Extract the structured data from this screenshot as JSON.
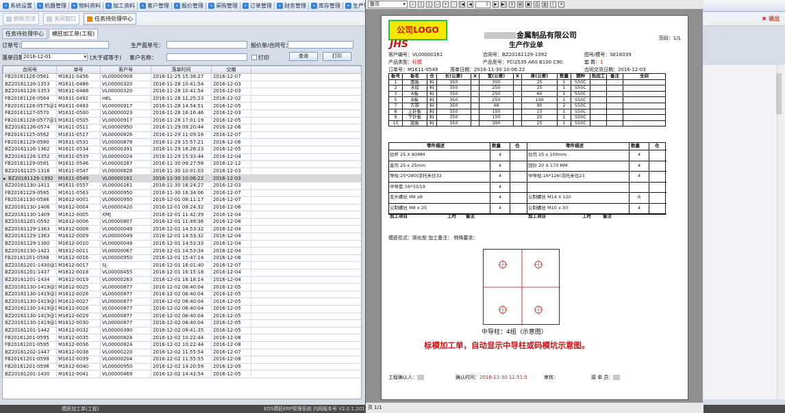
{
  "toolbar": {
    "items": [
      "系统设置",
      "机器管理",
      "物料资料",
      "加工资料",
      "客户管理",
      "报价管理",
      "采购管理",
      "订单管理",
      "财务管理",
      "库存管理",
      "生产管"
    ]
  },
  "row2": {
    "btn1": "刷新方法",
    "btn2": "关闭窗口",
    "btn3": "任务待处理中心",
    "exit": "退出"
  },
  "tabs": [
    "任务待处理中心",
    "模胚加工单(工程)"
  ],
  "filters": {
    "order_no_label": "订单号：",
    "production_no_label": "生产面单号：",
    "quote_label": "报价单/合同号：",
    "date_label": "落单日期：",
    "date_value": "2016-12-01",
    "date_hint": "(大于或等于)",
    "customer_label": "客户名称：",
    "print_label": "打印",
    "query_btn": "查询",
    "print_btn": "打印"
  },
  "grid": {
    "headers": [
      "合同号",
      "单号",
      "客户号",
      "落单时间",
      "交期"
    ],
    "rows": [
      [
        "FB20161126-0561",
        "M1611-0456",
        "VL00000908",
        "2016-11-25 15:38:27",
        "2016-12-07"
      ],
      [
        "BZ20161126-1353",
        "M1611-0486",
        "VL00000320",
        "2016-11-28 10:41:54",
        "2016-12-03"
      ],
      [
        "BZ20161126-1353",
        "M1611-0488",
        "VL00000320",
        "2016-11-28 10:41:54",
        "2016-12-03"
      ],
      [
        "FB20161126-0564",
        "M1611-0492",
        "HKL",
        "2016-11-28 11:25:23",
        "2016-12-02"
      ],
      [
        "FB20161128-0575@1",
        "M1611-0493",
        "VL00000917",
        "2016-11-28 14:54:51",
        "2016-12-05"
      ],
      [
        "FB20161127-0570",
        "M1611-0500",
        "VL00000023",
        "2016-11-28 16:16:46",
        "2016-12-03"
      ],
      [
        "FB20161128-0577@1",
        "M1611-0505",
        "VL00000917",
        "2016-11-28 17:01:19",
        "2016-12-05"
      ],
      [
        "BZ20161126-0574",
        "M1611-0511",
        "VL00000950",
        "2016-11-29 09:20:44",
        "2016-12-06"
      ],
      [
        "FB20161125-0562",
        "M1611-0517",
        "VL00000826",
        "2016-11-29 11:09:16",
        "2016-12-07"
      ],
      [
        "FB20161129-0580",
        "M1611-0531",
        "VL00000878",
        "2016-11-29 15:57:21",
        "2016-12-06"
      ],
      [
        "BZ20161126-1362",
        "M1611-0534",
        "VL00000391",
        "2016-11-29 16:26:23",
        "2016-12-05"
      ],
      [
        "BZ20161126-1352",
        "M1611-0539",
        "VL00000024",
        "2016-11-29 15:33:44",
        "2016-12-04"
      ],
      [
        "FB20161129-0581",
        "M1611-0546",
        "VL00000287",
        "2016-11-30 09:27:58",
        "2016-12-12"
      ],
      [
        "BZ20161125-1316",
        "M1611-0547",
        "VL00000828",
        "2016-11-30 10:01:03",
        "2016-12-03"
      ],
      [
        "BZ20161129-1392",
        "M1611-0549",
        "VL00000161",
        "2016-11-30 10:06:22",
        "2016-12-03"
      ],
      [
        "BZ20161130-1411",
        "M1611-0557",
        "VL00000161",
        "2016-11-30 16:24:27",
        "2016-12-03"
      ],
      [
        "FB20161129-0585",
        "M1611-0563",
        "VL00000950",
        "2016-11-30 16:34:06",
        "2016-12-07"
      ],
      [
        "FB20161130-0586",
        "M1612-0001",
        "VL00000950",
        "2016-12-01 08:11:17",
        "2016-12-07"
      ],
      [
        "BZ20161130-1406",
        "M1612-0004",
        "VL00000420",
        "2016-12-01 09:24:32",
        "2016-12-06"
      ],
      [
        "BZ20161130-1409",
        "M1612-0005",
        "XMJ",
        "2016-12-01 11:42:39",
        "2016-12-04"
      ],
      [
        "BZ20161201-0592",
        "M1612-0006",
        "VL00000807",
        "2016-12-01 11:49:36",
        "2016-12-08"
      ],
      [
        "BZ20161129-1363",
        "M1612-0008",
        "VL00000049",
        "2016-12-01 14:53:32",
        "2016-12-04"
      ],
      [
        "BZ20161129-1363",
        "M1612-0009",
        "VL00000049",
        "2016-12-01 14:53:32",
        "2016-12-04"
      ],
      [
        "BZ20161129-1380",
        "M1612-0010",
        "VL00000049",
        "2016-12-01 14:53:33",
        "2016-12-04"
      ],
      [
        "BZ20161130-1421",
        "M1612-0011",
        "VL00000067",
        "2016-12-01 14:53:34",
        "2016-12-04"
      ],
      [
        "FB20161201-0588",
        "M1612-0016",
        "VL00000950",
        "2016-12-01 15:47:14",
        "2016-12-08"
      ],
      [
        "BZ20161201-1430@1",
        "M1612-0017",
        "SJ",
        "2016-12-01 16:01:40",
        "2016-12-07"
      ],
      [
        "BZ20161201-1437",
        "M1612-0018",
        "VL00000455",
        "2016-12-01 16:15:18",
        "2016-12-04"
      ],
      [
        "BZ20161201-1434",
        "M1612-0019",
        "VL00000263",
        "2016-12-01 16:18:14",
        "2016-12-04"
      ],
      [
        "BZ20161130-1419@1",
        "M1612-0025",
        "VL00000877",
        "2016-12-02 08:40:04",
        "2016-12-05"
      ],
      [
        "BZ20161130-1419@1",
        "M1612-0026",
        "VL00000877",
        "2016-12-02 08:40:04",
        "2016-12-05"
      ],
      [
        "BZ20161130-1419@1",
        "M1612-0027",
        "VL00000877",
        "2016-12-02 08:40:04",
        "2016-12-05"
      ],
      [
        "BZ20161130-1419@1",
        "M1612-0028",
        "VL00000877",
        "2016-12-02 08:40:04",
        "2016-12-05"
      ],
      [
        "BZ20161130-1419@1",
        "M1612-0029",
        "VL00000877",
        "2016-12-02 08:40:04",
        "2016-12-05"
      ],
      [
        "BZ20161130-1419@1",
        "M1612-0030",
        "VL00000877",
        "2016-12-02 08:40:04",
        "2016-12-05"
      ],
      [
        "BZ20161201-1442",
        "M1612-0032",
        "VL00000390",
        "2016-12-02 09:41:35",
        "2016-12-05"
      ],
      [
        "FB20161201-0595",
        "M1612-0035",
        "VL00000824",
        "2016-12-02 10:22:44",
        "2016-12-08"
      ],
      [
        "FB20161201-0595",
        "M1612-0036",
        "VL00000824",
        "2016-12-02 10:22:44",
        "2016-12-08"
      ],
      [
        "BZ20161202-1447",
        "M1612-0038",
        "VL00000220",
        "2016-12-02 11:55:54",
        "2016-12-07"
      ],
      [
        "FB20161201-0599",
        "M1612-0039",
        "VL00000204",
        "2016-12-02 11:55:55",
        "2016-12-08"
      ],
      [
        "FB20161201-0598",
        "M1612-0040",
        "VL00000950",
        "2016-12-02 14:20:59",
        "2016-12-09"
      ],
      [
        "BZ20161201-1430",
        "M1612-0041",
        "VL00000469",
        "2016-12-02 14:43:54",
        "2016-12-05"
      ]
    ],
    "selected_index": 14
  },
  "statusbar": {
    "left": "模胚加工单(工程)",
    "mid": "EOS模胚ERP管理系统 内网版本号 V2.0.1.2016"
  },
  "viewer": {
    "zoom": "整页",
    "page_input": "1",
    "page_status": "页 1/1",
    "doc": {
      "logo_text": "公司LOGO",
      "logo_sub": "JHS",
      "company": "金属制品有限公司",
      "title": "生产作业单",
      "page": "页码：1/1",
      "customer_no": "客户编号：VL00000161",
      "contract_no": "合同号：BZ20161129-1392",
      "drawing_no": "图号/模号：SE18039",
      "product_type_label": "产品类型：",
      "product_type_value": "标模",
      "product_spec": "产品型号：FCI2535 A60 B100 C90",
      "set_qty_label": "套  数：",
      "set_qty_value": "1",
      "order_no": "订单号：M1611-0549",
      "order_date": "落单日期：2016-11-30 10:06:22",
      "delivery_date": "合同交货日期：2016-12-03",
      "plates_header": [
        "板号",
        "板名",
        "仓",
        "长(公差)",
        "X",
        "宽(公差)",
        "X",
        "厚(公差)",
        "数量",
        "钢种",
        "热加工",
        "备注",
        "全间"
      ],
      "plates": [
        [
          "1",
          "面板",
          "料",
          "350",
          "",
          "300",
          "",
          "25",
          "1",
          "S50C"
        ],
        [
          "2",
          "水搅",
          "料",
          "350",
          "",
          "250",
          "",
          "25",
          "1",
          "S50C"
        ],
        [
          "3",
          "A板",
          "料",
          "350",
          "",
          "250",
          "",
          "60",
          "1",
          "S50C"
        ],
        [
          "5",
          "B板",
          "料",
          "350",
          "",
          "250",
          "",
          "100",
          "1",
          "S50C"
        ],
        [
          "7",
          "方铁",
          "料",
          "350",
          "",
          "48",
          "",
          "90",
          "2",
          "S50C"
        ],
        [
          "8",
          "上针板",
          "料",
          "350",
          "",
          "150",
          "",
          "15",
          "1",
          "S50C"
        ],
        [
          "9",
          "下针板",
          "料",
          "350",
          "",
          "150",
          "",
          "20",
          "1",
          "S50C"
        ],
        [
          "10",
          "底板",
          "料",
          "350",
          "",
          "300",
          "",
          "25",
          "1",
          "S50C"
        ]
      ],
      "parts_header_left": "零件描述",
      "parts_header_right": "零件描述",
      "qty_label": "数量",
      "warehouse_label": "仓",
      "parts_left": [
        [
          "拉杆 25 X 80MM",
          "4"
        ],
        [
          "直司 25 x 25mm",
          "4"
        ],
        [
          "导柱:25*280(淬托米位32",
          "4"
        ],
        [
          "中导套:16*33/19",
          "4"
        ],
        [
          "无头螺丝 M8 x8",
          "4"
        ],
        [
          "公制螺丝 M8 x 25",
          "4"
        ]
      ],
      "parts_right": [
        [
          "拉司 25 x 100mm",
          "4"
        ],
        [
          "回针 20 X 170 MM",
          "4"
        ],
        [
          "中导柱:16*126(淬托米位23",
          "4"
        ],
        [
          "",
          ""
        ],
        [
          "公制螺丝 M14 X 120",
          "6"
        ],
        [
          "公制螺丝 M10 x 30",
          "4"
        ]
      ],
      "process_item": "加工项目",
      "hours": "工时",
      "remark": "备注",
      "pattern_line": "模胚花式：简化型  加工备注：  特殊要求：",
      "diagram_label": "中导柱：4组（示意图）",
      "annotation": "标模加工单，自动显示中导柱或码模坑示意图。",
      "engineer": "工程确认人：",
      "confirm_time_label": "确认时间：",
      "confirm_time_value": "2016-11-30 11:51:5",
      "checker": "审核：",
      "receiver": "接 单 员："
    }
  }
}
